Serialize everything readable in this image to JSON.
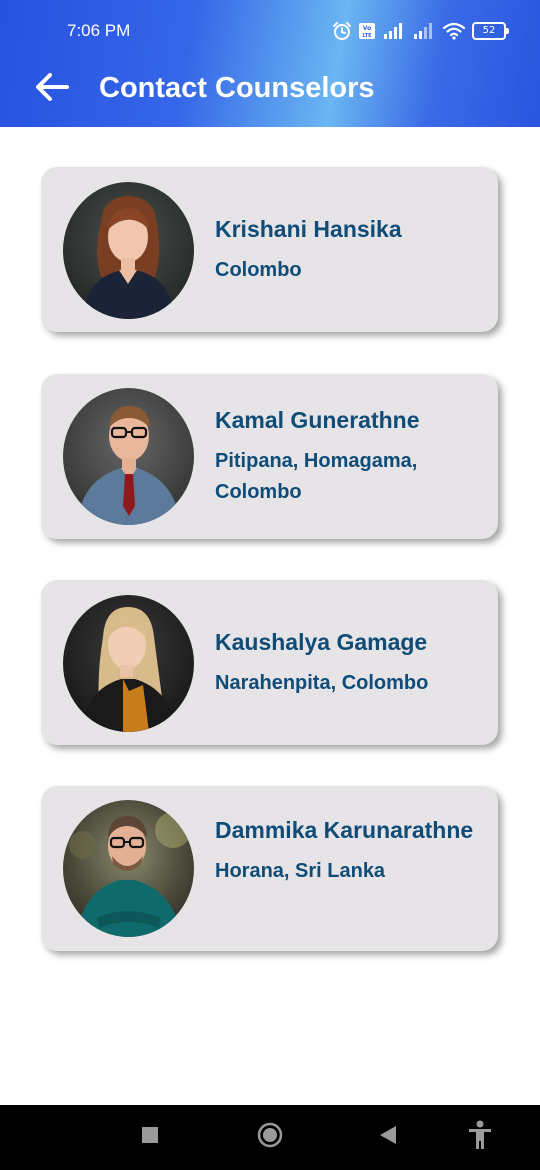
{
  "status_bar": {
    "time": "7:06 PM",
    "battery": "52",
    "volte": "VoLTE"
  },
  "header": {
    "title": "Contact Counselors"
  },
  "counselors": [
    {
      "name": "Krishani Hansika",
      "location": "Colombo"
    },
    {
      "name": "Kamal Gunerathne",
      "location": "Pitipana, Homagama, Colombo"
    },
    {
      "name": "Kaushalya Gamage",
      "location": "Narahenpita, Colombo"
    },
    {
      "name": "Dammika Karunarathne",
      "location": "Horana, Sri Lanka"
    }
  ],
  "colors": {
    "header_gradient_start": "#2752e0",
    "header_gradient_mid": "#6ab6f2",
    "card_background": "#e6e4e6",
    "text_primary": "#0f4c78"
  },
  "icons": {
    "back": "arrow-left-icon",
    "alarm": "alarm-icon",
    "signal": "signal-icon",
    "wifi": "wifi-icon",
    "nav_recents": "square-icon",
    "nav_home": "circle-icon",
    "nav_back": "triangle-icon",
    "accessibility": "accessibility-icon"
  }
}
